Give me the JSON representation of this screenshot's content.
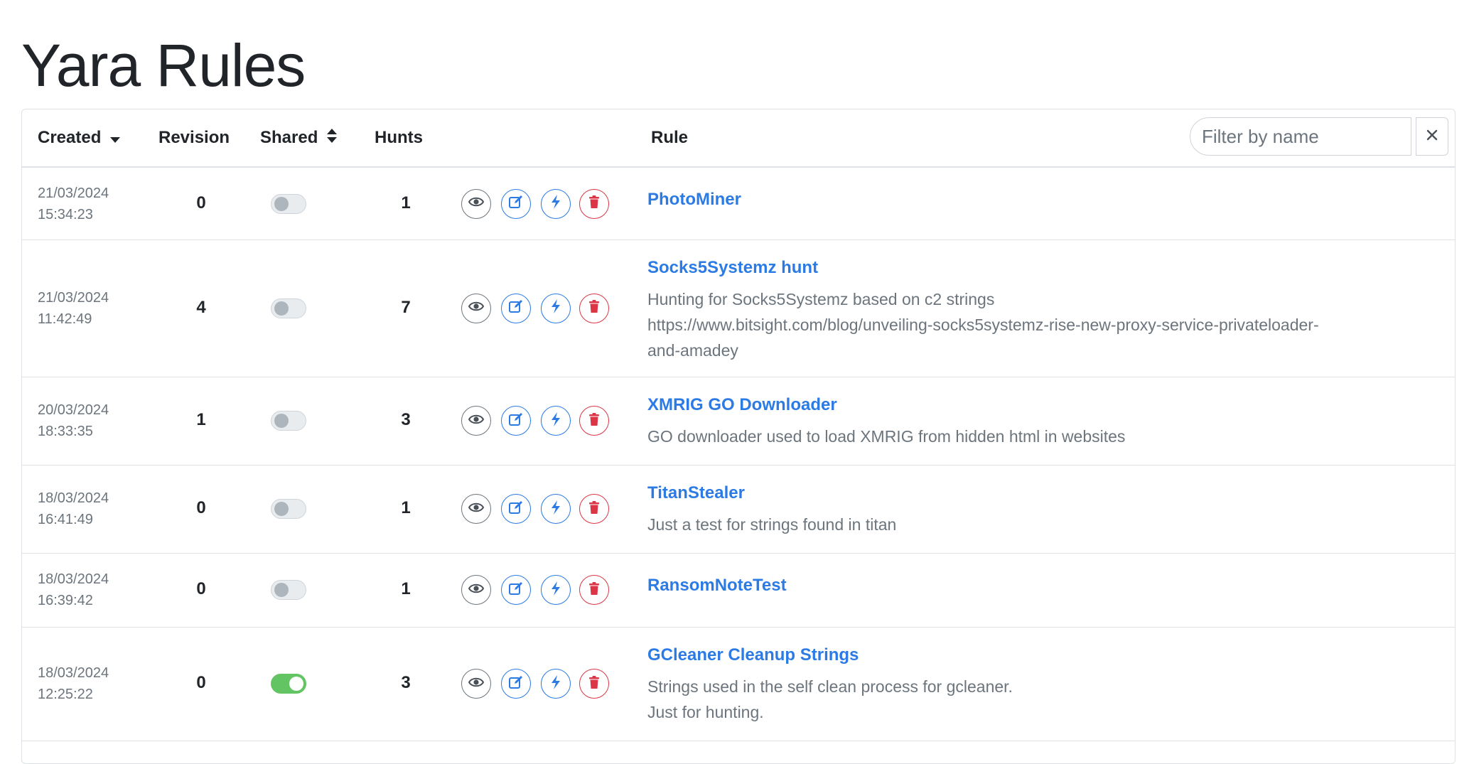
{
  "page": {
    "title": "Yara Rules"
  },
  "table": {
    "headers": {
      "created": "Created",
      "revision": "Revision",
      "shared": "Shared",
      "hunts": "Hunts",
      "rule": "Rule"
    },
    "filter": {
      "placeholder": "Filter by name",
      "value": "",
      "clear_icon": "close-icon"
    },
    "actions": [
      "eye-icon",
      "edit-icon",
      "bolt-icon",
      "trash-icon"
    ],
    "rows": [
      {
        "date": "21/03/2024",
        "time": "15:34:23",
        "revision": "0",
        "shared": false,
        "hunts": "1",
        "name": "PhotoMiner",
        "description": ""
      },
      {
        "date": "21/03/2024",
        "time": "11:42:49",
        "revision": "4",
        "shared": false,
        "hunts": "7",
        "name": "Socks5Systemz hunt",
        "description": "Hunting for Socks5Systemz based on c2 strings\nhttps://www.bitsight.com/blog/unveiling-socks5systemz-rise-new-proxy-service-privateloader-\nand-amadey"
      },
      {
        "date": "20/03/2024",
        "time": "18:33:35",
        "revision": "1",
        "shared": false,
        "hunts": "3",
        "name": "XMRIG GO Downloader",
        "description": "GO downloader used to load XMRIG from hidden html in websites"
      },
      {
        "date": "18/03/2024",
        "time": "16:41:49",
        "revision": "0",
        "shared": false,
        "hunts": "1",
        "name": "TitanStealer",
        "description": "Just a test for strings found in titan"
      },
      {
        "date": "18/03/2024",
        "time": "16:39:42",
        "revision": "0",
        "shared": false,
        "hunts": "1",
        "name": "RansomNoteTest",
        "description": ""
      },
      {
        "date": "18/03/2024",
        "time": "12:25:22",
        "revision": "0",
        "shared": true,
        "hunts": "3",
        "name": "GCleaner Cleanup Strings",
        "description": "Strings used in the self clean process for gcleaner.\nJust for hunting."
      }
    ]
  },
  "colors": {
    "link": "#2c7be5",
    "danger": "#dc3545",
    "muted": "#6c757d",
    "toggle_on": "#62c462"
  }
}
